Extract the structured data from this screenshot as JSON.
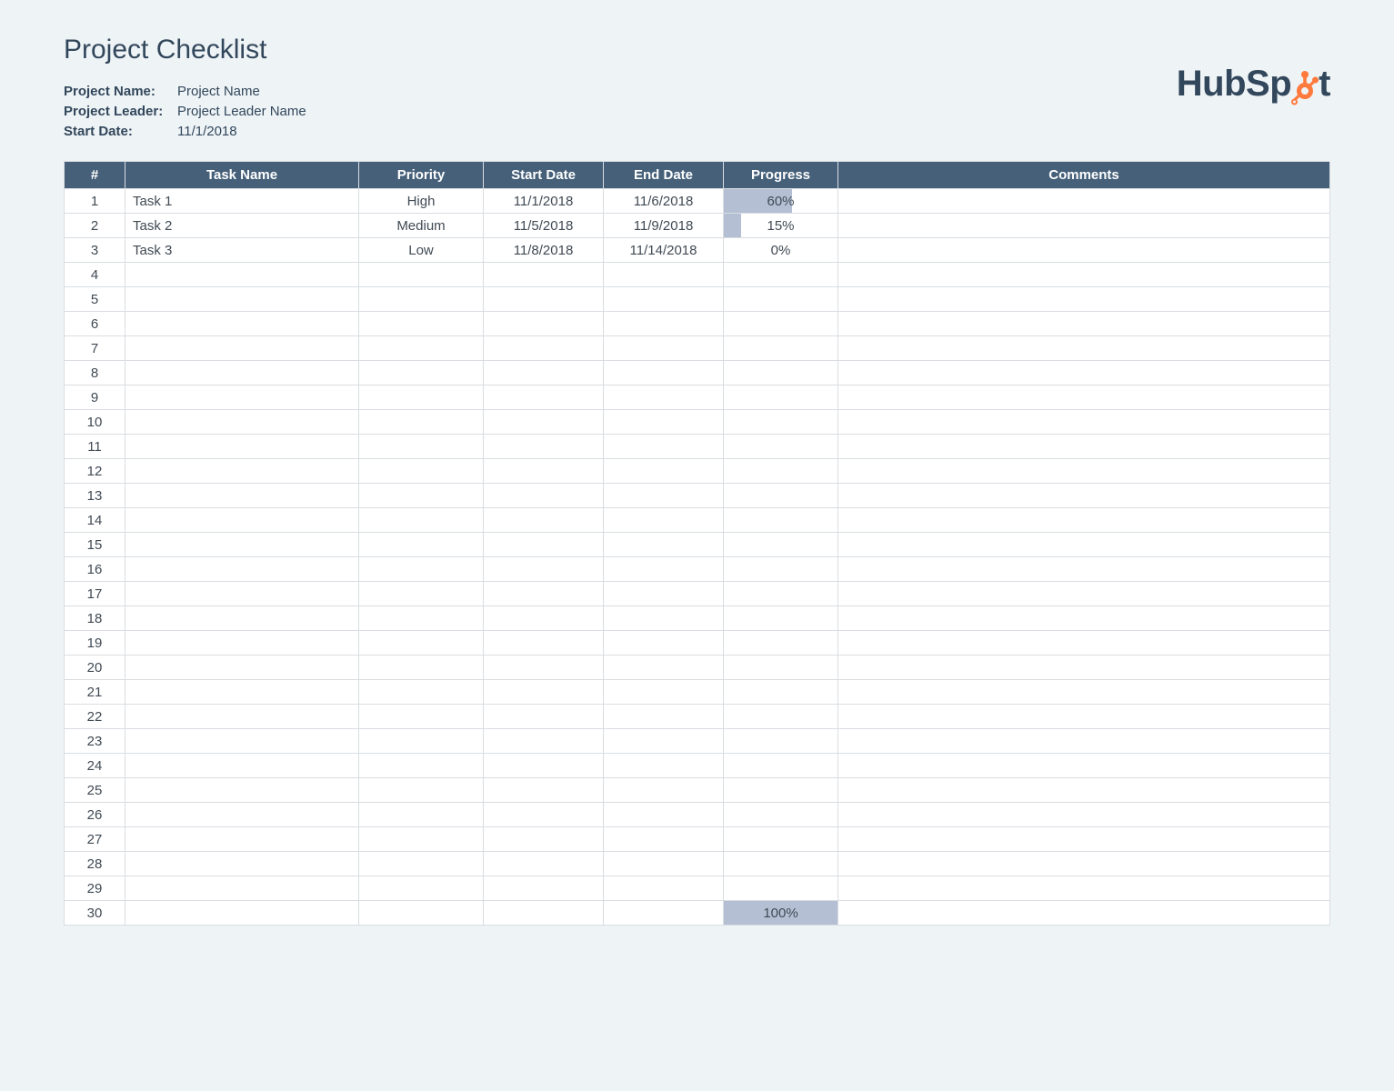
{
  "title": "Project Checklist",
  "meta": {
    "project_name_label": "Project Name:",
    "project_name_value": "Project Name",
    "project_leader_label": "Project Leader:",
    "project_leader_value": "Project Leader Name",
    "start_date_label": "Start Date:",
    "start_date_value": "11/1/2018"
  },
  "logo": {
    "text_left": "HubSp",
    "text_right": "t",
    "accent_color": "#ff7a3c"
  },
  "columns": {
    "num": "#",
    "task": "Task Name",
    "priority": "Priority",
    "start": "Start Date",
    "end": "End Date",
    "progress": "Progress",
    "comments": "Comments"
  },
  "total_rows": 30,
  "rows": [
    {
      "n": 1,
      "task": "Task 1",
      "priority": "High",
      "start": "11/1/2018",
      "end": "11/6/2018",
      "progress_pct": 60,
      "progress_text": "60%",
      "comments": ""
    },
    {
      "n": 2,
      "task": "Task 2",
      "priority": "Medium",
      "start": "11/5/2018",
      "end": "11/9/2018",
      "progress_pct": 15,
      "progress_text": "15%",
      "comments": ""
    },
    {
      "n": 3,
      "task": "Task 3",
      "priority": "Low",
      "start": "11/8/2018",
      "end": "11/14/2018",
      "progress_pct": 0,
      "progress_text": "0%",
      "comments": ""
    }
  ],
  "footer_progress": {
    "pct": 100,
    "text": "100%"
  }
}
